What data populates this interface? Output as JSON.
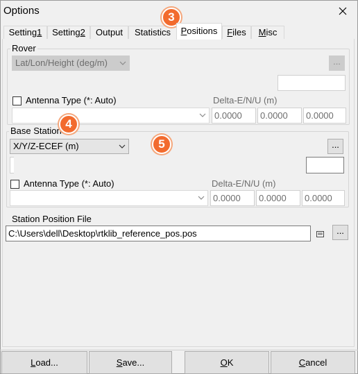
{
  "window": {
    "title": "Options"
  },
  "tabs": [
    {
      "pre": "Setting",
      "u": "1",
      "post": ""
    },
    {
      "pre": "Setting",
      "u": "2",
      "post": ""
    },
    {
      "pre": "Output",
      "u": "",
      "post": ""
    },
    {
      "pre": "Statistics",
      "u": "",
      "post": ""
    },
    {
      "pre": "",
      "u": "P",
      "post": "ositions"
    },
    {
      "pre": "",
      "u": "F",
      "post": "iles"
    },
    {
      "pre": "",
      "u": "M",
      "post": "isc"
    }
  ],
  "rover": {
    "label": "Rover",
    "format": "Lat/Lon/Height (deg/m)",
    "browse": "...",
    "antenna_label": "Antenna Type (*: Auto)",
    "delta_label": "Delta-E/N/U (m)",
    "delta": [
      "0.0000",
      "0.0000",
      "0.0000"
    ]
  },
  "base": {
    "label": "Base Station",
    "format": "X/Y/Z-ECEF (m)",
    "browse": "...",
    "antenna_label": "Antenna Type (*: Auto)",
    "delta_label": "Delta-E/N/U (m)",
    "delta": [
      "0.0000",
      "0.0000",
      "0.0000"
    ]
  },
  "station": {
    "label": "Station Position File",
    "path": "C:\\Users\\dell\\Desktop\\rtklib_reference_pos.pos",
    "browse": "..."
  },
  "badges": [
    "3",
    "4",
    "5"
  ],
  "buttons": {
    "load": {
      "u": "L",
      "post": "oad..."
    },
    "save": {
      "u": "S",
      "post": "ave..."
    },
    "ok": {
      "u": "O",
      "post": "K"
    },
    "cancel": {
      "u": "C",
      "post": "ancel"
    }
  },
  "colors": {
    "badge": "#f26b2e",
    "active_tab": "#ffffff"
  }
}
